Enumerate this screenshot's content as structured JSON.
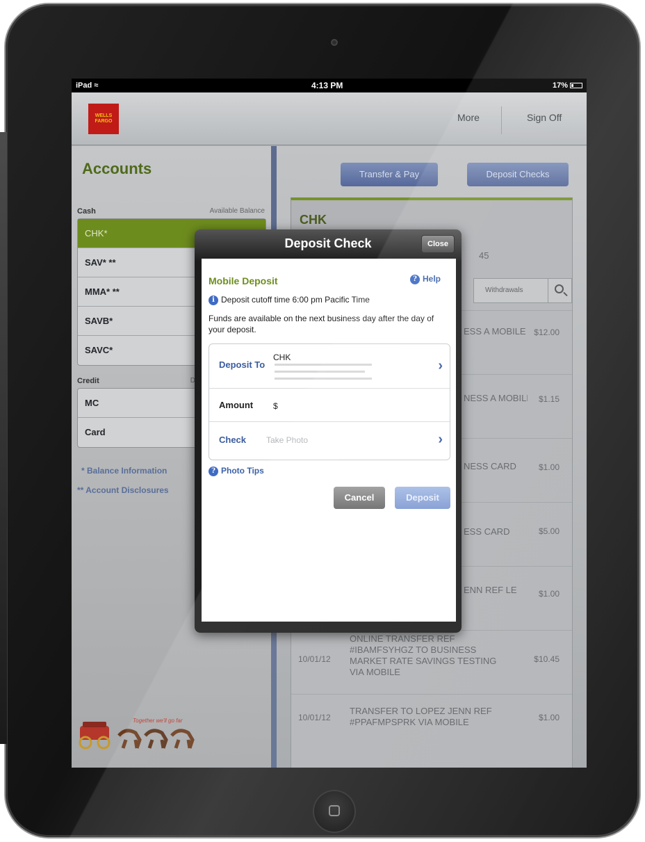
{
  "statusbar": {
    "carrier": "iPad",
    "time": "4:13 PM",
    "battery": "17%"
  },
  "brand": {
    "logo_text": "WELLS FARGO",
    "tagline": "Together we'll go far"
  },
  "topbar": {
    "more": "More",
    "sign_off": "Sign Off"
  },
  "sidebar": {
    "title": "Accounts",
    "cash_label": "Cash",
    "cash_right": "Available Balance",
    "cash_accounts": [
      "CHK*",
      "SAV* **",
      "MMA* **",
      "SAVB*",
      "SAVC*"
    ],
    "credit_label": "Credit",
    "credit_right": "D",
    "credit_accounts": [
      "MC",
      "Card"
    ],
    "balance_info": "* Balance Information",
    "disclosures": "** Account Disclosures"
  },
  "main": {
    "transfer_pay": "Transfer & Pay",
    "deposit_checks": "Deposit Checks",
    "chk_title": "CHK",
    "chk_balance": "45",
    "filter": "Withdrawals",
    "transactions": [
      {
        "date": "",
        "desc": "ESS\nA MOBILE",
        "amount": "$12.00"
      },
      {
        "date": "",
        "desc": "NESS\nA MOBILE",
        "amount": "$1.15"
      },
      {
        "date": "",
        "desc": "NESS CARD",
        "amount": "$1.00"
      },
      {
        "date": "",
        "desc": "ESS CARD",
        "amount": "$5.00"
      },
      {
        "date": "",
        "desc": "ENN REF\nLE",
        "amount": "$1.00"
      },
      {
        "date": "10/01/12",
        "desc": "ONLINE TRANSFER REF\n#IBAMFSYHGZ TO BUSINESS\nMARKET RATE SAVINGS TESTING\nVIA MOBILE",
        "amount": "$10.45"
      },
      {
        "date": "10/01/12",
        "desc": "TRANSFER TO LOPEZ JENN REF\n#PPAFMPSPRK VIA MOBILE",
        "amount": "$1.00"
      }
    ]
  },
  "modal": {
    "title": "Deposit Check",
    "close": "Close",
    "mobile_deposit": "Mobile Deposit",
    "help": "Help",
    "cutoff": "Deposit cutoff time 6:00 pm Pacific Time",
    "funds": "Funds are available on the next business day after the day of your deposit.",
    "deposit_to_label": "Deposit To",
    "deposit_to_value": "CHK",
    "amount_label": "Amount",
    "amount_value": "$",
    "check_label": "Check",
    "check_value": "Take Photo",
    "photo_tips": "Photo Tips",
    "cancel": "Cancel",
    "deposit": "Deposit"
  },
  "colors": {
    "brand_red": "#c11b17",
    "accent_green": "#6d8e1e",
    "link_blue": "#3b5c9f"
  }
}
